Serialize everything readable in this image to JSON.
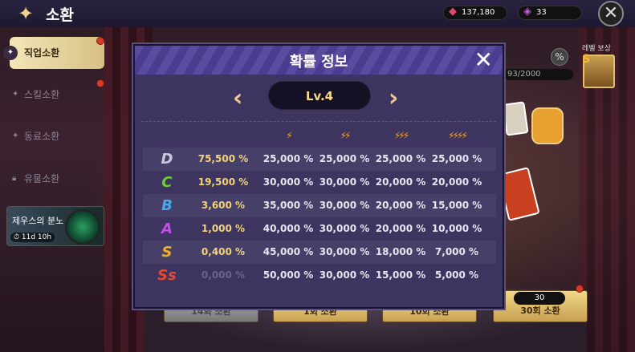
{
  "header": {
    "title": "소환",
    "currency1": "137,180",
    "currency2": "33"
  },
  "sidebar": {
    "items": [
      {
        "label": "직업소환",
        "active": true
      },
      {
        "label": "스킬소환"
      },
      {
        "label": "동료소환"
      },
      {
        "label": "유물소환"
      }
    ],
    "event": {
      "title": "제우스의 분노",
      "timer": "11d 10h"
    }
  },
  "side_panel": {
    "reward_label": "레벨 보상",
    "progress": "93/2000",
    "percent_icon": "%"
  },
  "buttons": {
    "b14": "14회 소환",
    "b1": "1회 소환",
    "b10": "10회 소환",
    "b30": "30회 소환",
    "b30_cost": "30"
  },
  "modal": {
    "title": "확률 정보",
    "level": "Lv.4",
    "tier_icons": [
      "⚡",
      "⚡⚡",
      "⚡⚡⚡",
      "⚡⚡⚡⚡"
    ],
    "rows": [
      {
        "grade": "D",
        "color": "#c8c8d8",
        "base": "75,500 %",
        "t1": "25,000 %",
        "t2": "25,000 %",
        "t3": "25,000 %",
        "t4": "25,000 %"
      },
      {
        "grade": "C",
        "color": "#6ad030",
        "base": "19,500 %",
        "t1": "30,000 %",
        "t2": "30,000 %",
        "t3": "20,000 %",
        "t4": "20,000 %"
      },
      {
        "grade": "B",
        "color": "#4aa8f0",
        "base": "3,600 %",
        "t1": "35,000 %",
        "t2": "30,000 %",
        "t3": "20,000 %",
        "t4": "15,000 %"
      },
      {
        "grade": "A",
        "color": "#c050e8",
        "base": "1,000 %",
        "t1": "40,000 %",
        "t2": "30,000 %",
        "t3": "20,000 %",
        "t4": "10,000 %"
      },
      {
        "grade": "S",
        "color": "#f5b020",
        "base": "0,400 %",
        "t1": "45,000 %",
        "t2": "30,000 %",
        "t3": "18,000 %",
        "t4": "7,000 %"
      },
      {
        "grade": "Ss",
        "color": "#e84830",
        "base": "0,000 %",
        "t1": "50,000 %",
        "t2": "30,000 %",
        "t3": "15,000 %",
        "t4": "5,000 %"
      }
    ]
  }
}
